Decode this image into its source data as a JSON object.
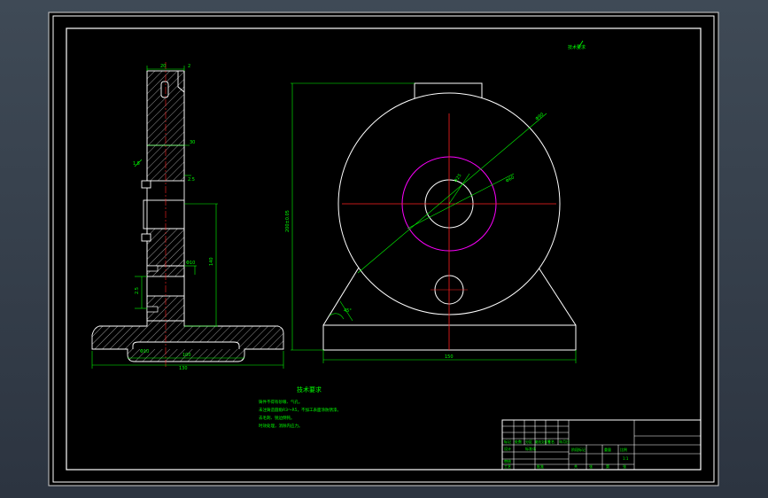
{
  "colors": {
    "background": "#2e3641",
    "paper": "#000000",
    "line": "#ffffff",
    "dimension": "#00ff00",
    "centerline": "#ff2020",
    "bolt_circle": "#ff00ff"
  },
  "drawing": {
    "corner_note": "技术要求",
    "tech_req_title": "技术要求",
    "tech_req_lines": [
      "铸件不得有砂眼、气孔。",
      "未注铸造圆角R3～R5，不加工表面涂防锈漆。",
      "去毛刺、锐边倒钝。",
      "时效处理，消除内应力。"
    ],
    "side_view_dims": {
      "top_width": "20",
      "top_chamfer": "2",
      "mid_width": "30",
      "slot_a": "1.5",
      "slot_b": "2.5",
      "hole": "Φ10",
      "base_inner": "100",
      "base_total": "130",
      "height": "140"
    },
    "front_view_dims": {
      "overall_height": "200±0.05",
      "outer_diameter": "Φ90",
      "bolt_circle": "Φ60",
      "bore": "Φ25",
      "base_width": "150",
      "rib_angle": "45°"
    }
  },
  "title_block": {
    "row_labels": [
      "标记",
      "处数",
      "分区",
      "更改文件号",
      "签名",
      "年月日"
    ],
    "sign_labels": [
      "设计",
      "标准化",
      "审核",
      "工艺",
      "批准"
    ],
    "stage_labels": [
      "阶段标记",
      "重量",
      "比例"
    ],
    "scale": "1:1",
    "sheet": [
      "共",
      "张",
      "第",
      "张"
    ]
  }
}
